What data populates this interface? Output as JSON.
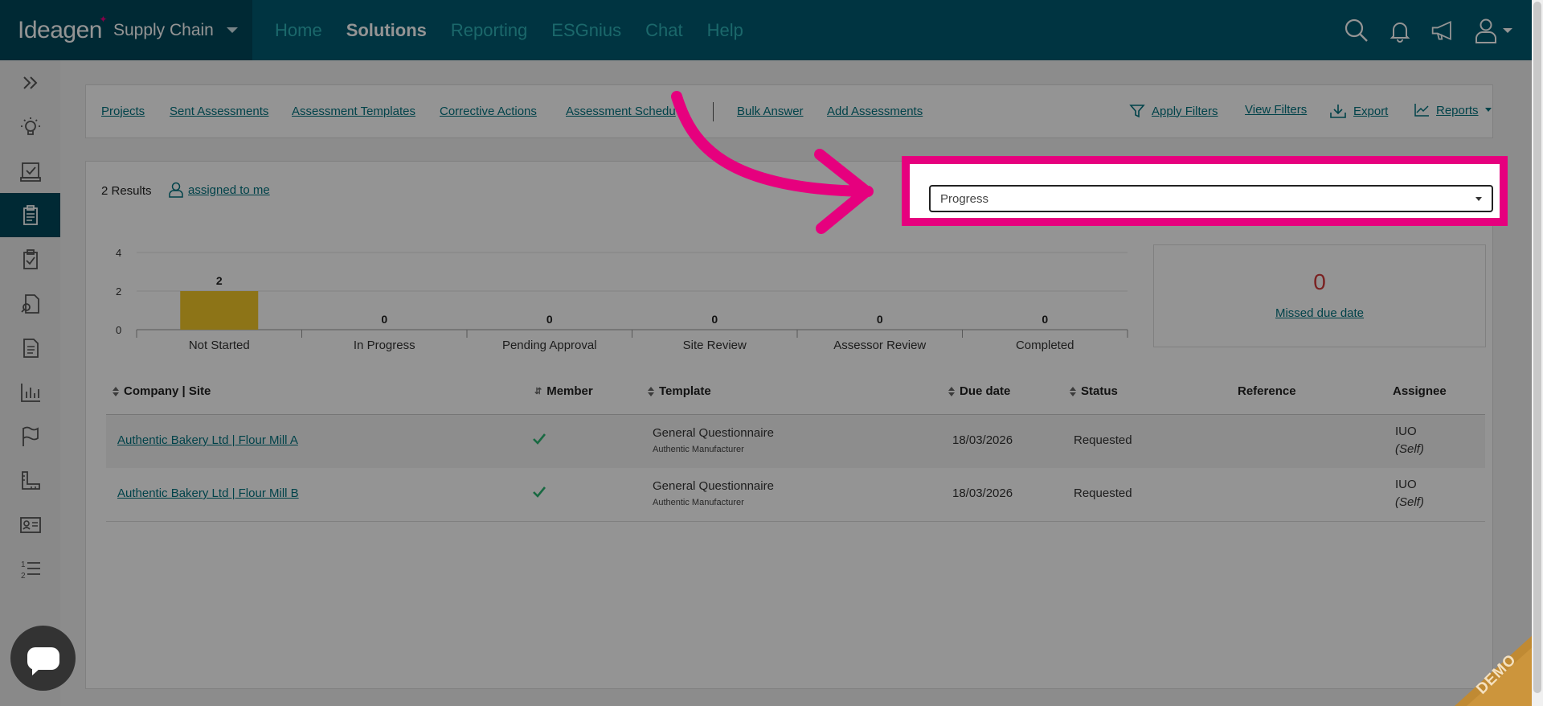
{
  "brand": {
    "logo": "Ideagen",
    "product": "Supply Chain"
  },
  "nav": {
    "items": [
      "Home",
      "Solutions",
      "Reporting",
      "ESGnius",
      "Chat",
      "Help"
    ],
    "active": "Solutions"
  },
  "subnav": {
    "links": [
      "Projects",
      "Sent Assessments",
      "Assessment Templates",
      "Corrective Actions",
      "Assessment Schedu",
      "Bulk Answer",
      "Add Assessments"
    ],
    "right": [
      "Apply Filters",
      "View Filters",
      "Export",
      "Reports"
    ]
  },
  "results": {
    "count_label": "2 Results",
    "assigned_label": "assigned to me"
  },
  "view_select": {
    "value": "Progress"
  },
  "chart_data": {
    "type": "bar",
    "categories": [
      "Not Started",
      "In Progress",
      "Pending Approval",
      "Site Review",
      "Assessor Review",
      "Completed"
    ],
    "values": [
      2,
      0,
      0,
      0,
      0,
      0
    ],
    "ylim": [
      0,
      4
    ],
    "yticks": [
      0,
      2,
      4
    ],
    "bar_color": "#f3c928"
  },
  "missed": {
    "count": "0",
    "label": "Missed due date"
  },
  "table": {
    "headers": [
      "Company | Site",
      "Member",
      "Template",
      "Due date",
      "Status",
      "Reference",
      "Assignee"
    ],
    "rows": [
      {
        "company": "Authentic Bakery Ltd | Flour Mill A",
        "template": "General Questionnaire",
        "template_sub": "Authentic Manufacturer",
        "due": "18/03/2026",
        "status": "Requested",
        "assignee": "IUO",
        "assignee_sub": "(Self)"
      },
      {
        "company": "Authentic Bakery Ltd | Flour Mill B",
        "template": "General Questionnaire",
        "template_sub": "Authentic Manufacturer",
        "due": "18/03/2026",
        "status": "Requested",
        "assignee": "IUO",
        "assignee_sub": "(Self)"
      }
    ]
  },
  "badge": {
    "demo": "DEMO"
  },
  "colors": {
    "highlight": "#e6007e",
    "nav_bg": "#005a70",
    "accent": "#00727f",
    "missed": "#d23a3a"
  }
}
